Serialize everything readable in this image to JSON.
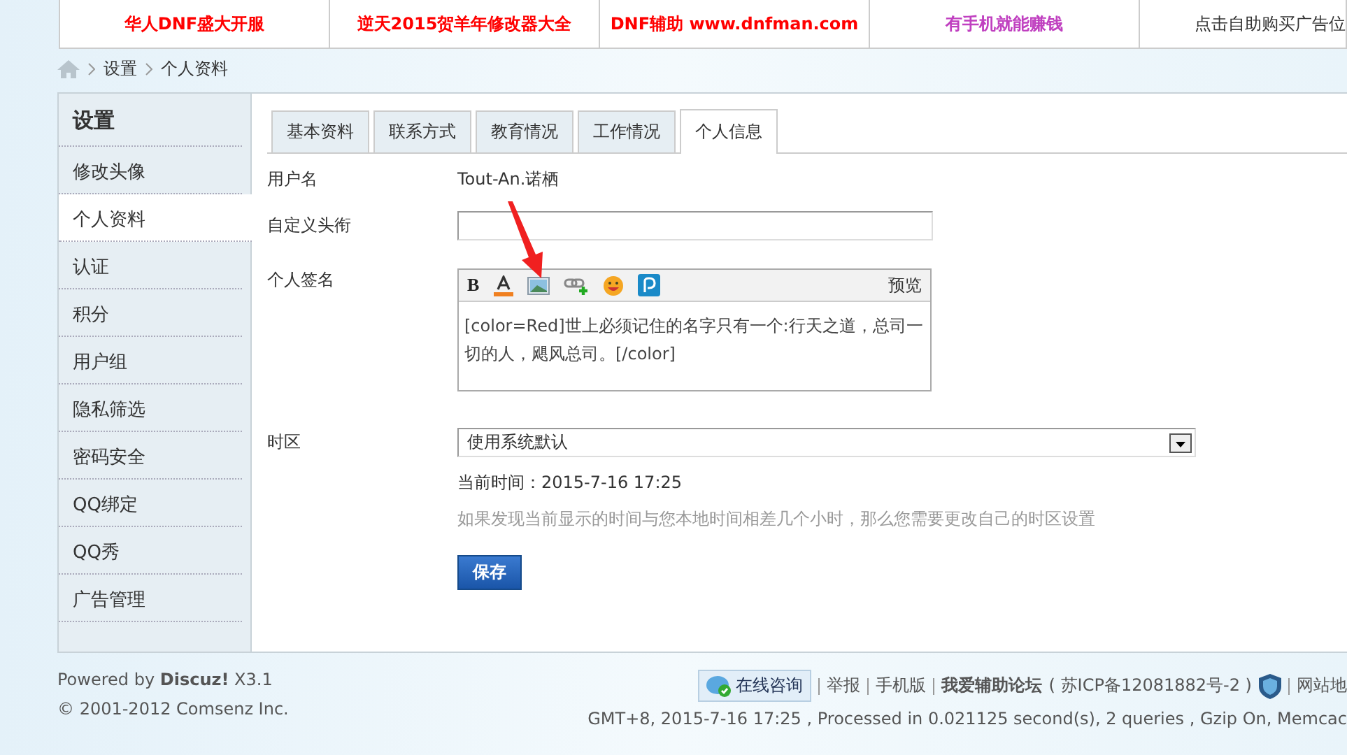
{
  "banner": [
    {
      "text": "华人DNF盛大开服",
      "color": "#ff0000"
    },
    {
      "text": "逆天2015贺羊年修改器大全",
      "color": "#ff0000"
    },
    {
      "text": "DNF辅助 www.dnfman.com",
      "color": "#ff0000"
    },
    {
      "text": "有手机就能赚钱",
      "color": "#c040c0"
    },
    {
      "text": "点击自助购买广告位",
      "color": "#333333"
    }
  ],
  "breadcrumb": [
    "设置",
    "个人资料"
  ],
  "sidebar": {
    "title": "设置",
    "items": [
      {
        "label": "修改头像",
        "selected": false
      },
      {
        "label": "个人资料",
        "selected": true
      },
      {
        "label": "认证",
        "selected": false
      },
      {
        "label": "积分",
        "selected": false
      },
      {
        "label": "用户组",
        "selected": false
      },
      {
        "label": "隐私筛选",
        "selected": false
      },
      {
        "label": "密码安全",
        "selected": false
      },
      {
        "label": "QQ绑定",
        "selected": false
      },
      {
        "label": "QQ秀",
        "selected": false
      },
      {
        "label": "广告管理",
        "selected": false
      }
    ]
  },
  "tabs": [
    {
      "label": "基本资料",
      "selected": false
    },
    {
      "label": "联系方式",
      "selected": false
    },
    {
      "label": "教育情况",
      "selected": false
    },
    {
      "label": "工作情况",
      "selected": false
    },
    {
      "label": "个人信息",
      "selected": true
    }
  ],
  "form": {
    "username_label": "用户名",
    "username": "Tout-An.诺栖",
    "title_label": "自定义头衔",
    "signature_label": "个人签名",
    "bold_label": "B",
    "preview": "预览",
    "signature": "[color=Red]世上必须记住的名字只有一个:行天之道，总司一切的人，飓风总司。[/color]",
    "timezone_label": "时区",
    "timezone": "使用系统默认",
    "current_time": "当前时间：2015-7-16 17:25",
    "hint": "如果发现当前显示的时间与您本地时间相差几个小时，那么您需要更改自己的时区设置",
    "save": "保存"
  },
  "annotation_arrow": true,
  "footer": {
    "powered": "Powered by **Discuz!** X3.1",
    "copyright": "© 2001-2012 Comsenz Inc.",
    "consult": "在线咨询",
    "links": [
      "举报",
      "手机版"
    ],
    "site": "我爱辅助论坛",
    "icp": "( 苏ICP备12081882号-2 )",
    "sitemap": "网站地",
    "stats": "GMT+8, 2015-7-16 17:25 , Processed in 0.021125 second(s), 2 queries , Gzip On, Memcac"
  }
}
